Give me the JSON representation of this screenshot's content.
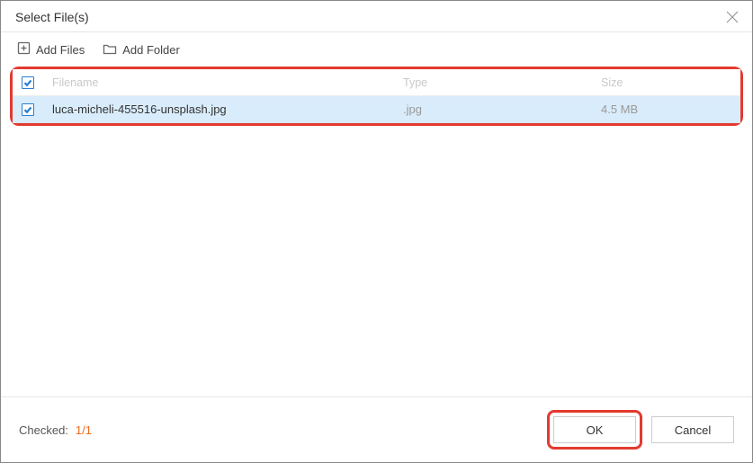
{
  "dialog": {
    "title": "Select File(s)"
  },
  "toolbar": {
    "add_files_label": "Add Files",
    "add_folder_label": "Add Folder"
  },
  "table": {
    "headers": {
      "filename": "Filename",
      "type": "Type",
      "size": "Size"
    },
    "rows": [
      {
        "checked": true,
        "filename": "luca-micheli-455516-unsplash.jpg",
        "type": ".jpg",
        "size": "4.5 MB"
      }
    ]
  },
  "footer": {
    "checked_label": "Checked:",
    "checked_count": "1/1",
    "ok_label": "OK",
    "cancel_label": "Cancel"
  }
}
